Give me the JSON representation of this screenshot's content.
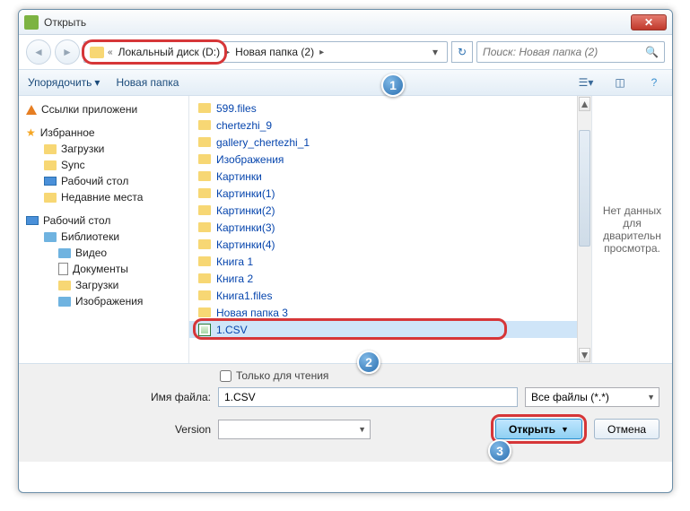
{
  "title": "Открыть",
  "close_glyph": "✕",
  "breadcrumb": {
    "prefix": "«",
    "part1": "Локальный диск (D:)",
    "part2": "Новая папка (2)"
  },
  "search": {
    "placeholder": "Поиск: Новая папка (2)"
  },
  "toolbar": {
    "organize": "Упорядочить",
    "newfolder": "Новая папка"
  },
  "sidebar": {
    "app_links": "Ссылки приложени",
    "favorites": "Избранное",
    "downloads": "Загрузки",
    "sync": "Sync",
    "desktop": "Рабочий стол",
    "recent": "Недавние места",
    "desktop2": "Рабочий стол",
    "libraries": "Библиотеки",
    "video": "Видео",
    "documents": "Документы",
    "downloads2": "Загрузки",
    "images": "Изображения"
  },
  "files": [
    {
      "name": "599.files",
      "type": "folder"
    },
    {
      "name": "chertezhi_9",
      "type": "folder"
    },
    {
      "name": "gallery_chertezhi_1",
      "type": "folder"
    },
    {
      "name": "Изображения",
      "type": "folder"
    },
    {
      "name": "Картинки",
      "type": "folder"
    },
    {
      "name": "Картинки(1)",
      "type": "folder"
    },
    {
      "name": "Картинки(2)",
      "type": "folder"
    },
    {
      "name": "Картинки(3)",
      "type": "folder"
    },
    {
      "name": "Картинки(4)",
      "type": "folder"
    },
    {
      "name": "Книга 1",
      "type": "folder"
    },
    {
      "name": "Книга 2",
      "type": "folder"
    },
    {
      "name": "Книга1.files",
      "type": "folder"
    },
    {
      "name": "Новая папка 3",
      "type": "folder"
    },
    {
      "name": "1.CSV",
      "type": "csv",
      "selected": true
    }
  ],
  "preview_text": "Нет данных для дварительн просмотра.",
  "footer": {
    "readonly_label": "Только для чтения",
    "filename_label": "Имя файла:",
    "filename_value": "1.CSV",
    "filter_value": "Все файлы (*.*)",
    "version_label": "Version",
    "open_btn": "Открыть",
    "cancel_btn": "Отмена"
  },
  "badges": {
    "b1": "1",
    "b2": "2",
    "b3": "3"
  }
}
